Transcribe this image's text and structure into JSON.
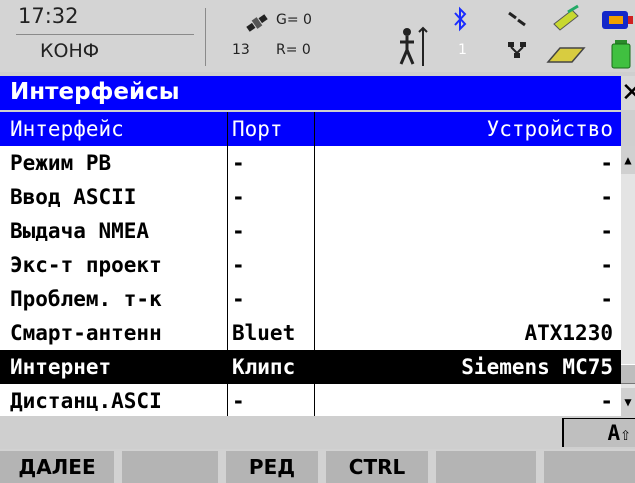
{
  "status": {
    "time": "17:32",
    "mode": "КОНФ",
    "sat_g": "G= 0",
    "sat_r": "R= 0",
    "sat_count": "13",
    "line_number": "1"
  },
  "window": {
    "title": "Интерфейсы"
  },
  "table": {
    "headers": {
      "interface": "Интерфейс",
      "port": "Порт",
      "device": "Устройство"
    },
    "rows": [
      {
        "interface": "Режим РВ",
        "port": "-",
        "device": "-"
      },
      {
        "interface": "Ввод ASCII",
        "port": "-",
        "device": "-"
      },
      {
        "interface": "Выдача NMEA",
        "port": "-",
        "device": "-"
      },
      {
        "interface": "Экс-т проект",
        "port": "-",
        "device": "-"
      },
      {
        "interface": "Проблем. т-к",
        "port": "-",
        "device": "-"
      },
      {
        "interface": "Смарт-антенн",
        "port": "Bluet",
        "device": "ATX1230"
      },
      {
        "interface": "Интернет",
        "port": "Клипс",
        "device": "Siemens MC75"
      },
      {
        "interface": "Дистанц.ASCI",
        "port": "-",
        "device": "-"
      }
    ],
    "selected_index": 6
  },
  "caps_indicator": "A",
  "fkeys": [
    "ДАЛЕЕ",
    "",
    "РЕД",
    "CTRL",
    "",
    ""
  ],
  "colors": {
    "title_bg": "#0000ff",
    "selection_bg": "#000000",
    "panel_bg": "#d4d4d4"
  }
}
